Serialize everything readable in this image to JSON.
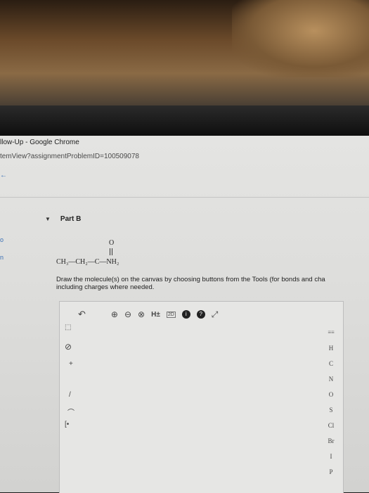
{
  "window": {
    "title": "llow-Up - Google Chrome",
    "url": "temView?assignmentProblemID=100509078"
  },
  "nav": {
    "back_glyph": "←"
  },
  "left_marks": [
    "o",
    "n"
  ],
  "part": {
    "caret": "▼",
    "label": "Part B"
  },
  "molecule": {
    "oxygen": "O",
    "formula_line": "CH₃—CH₂—C—NH₂"
  },
  "instructions": {
    "line1": "Draw the molecule(s) on the canvas by choosing buttons from the Tools (for bonds and cha",
    "line2": "including charges where needed."
  },
  "toolbar": {
    "undo": "↶",
    "zoom_in": "⊕",
    "zoom_out": "⊖",
    "clear": "⊗",
    "h_toggle": "H±",
    "template_2d": "2D",
    "info": "i",
    "help": "?",
    "expand": "⤢"
  },
  "left_tools": {
    "select": "⬚",
    "erase": "⊘",
    "charge": "+",
    "bond": "/",
    "chain": "⌒",
    "bracket": "[•"
  },
  "elements": [
    "≡≡",
    "H",
    "C",
    "N",
    "O",
    "S",
    "Cl",
    "Br",
    "I",
    "P"
  ]
}
